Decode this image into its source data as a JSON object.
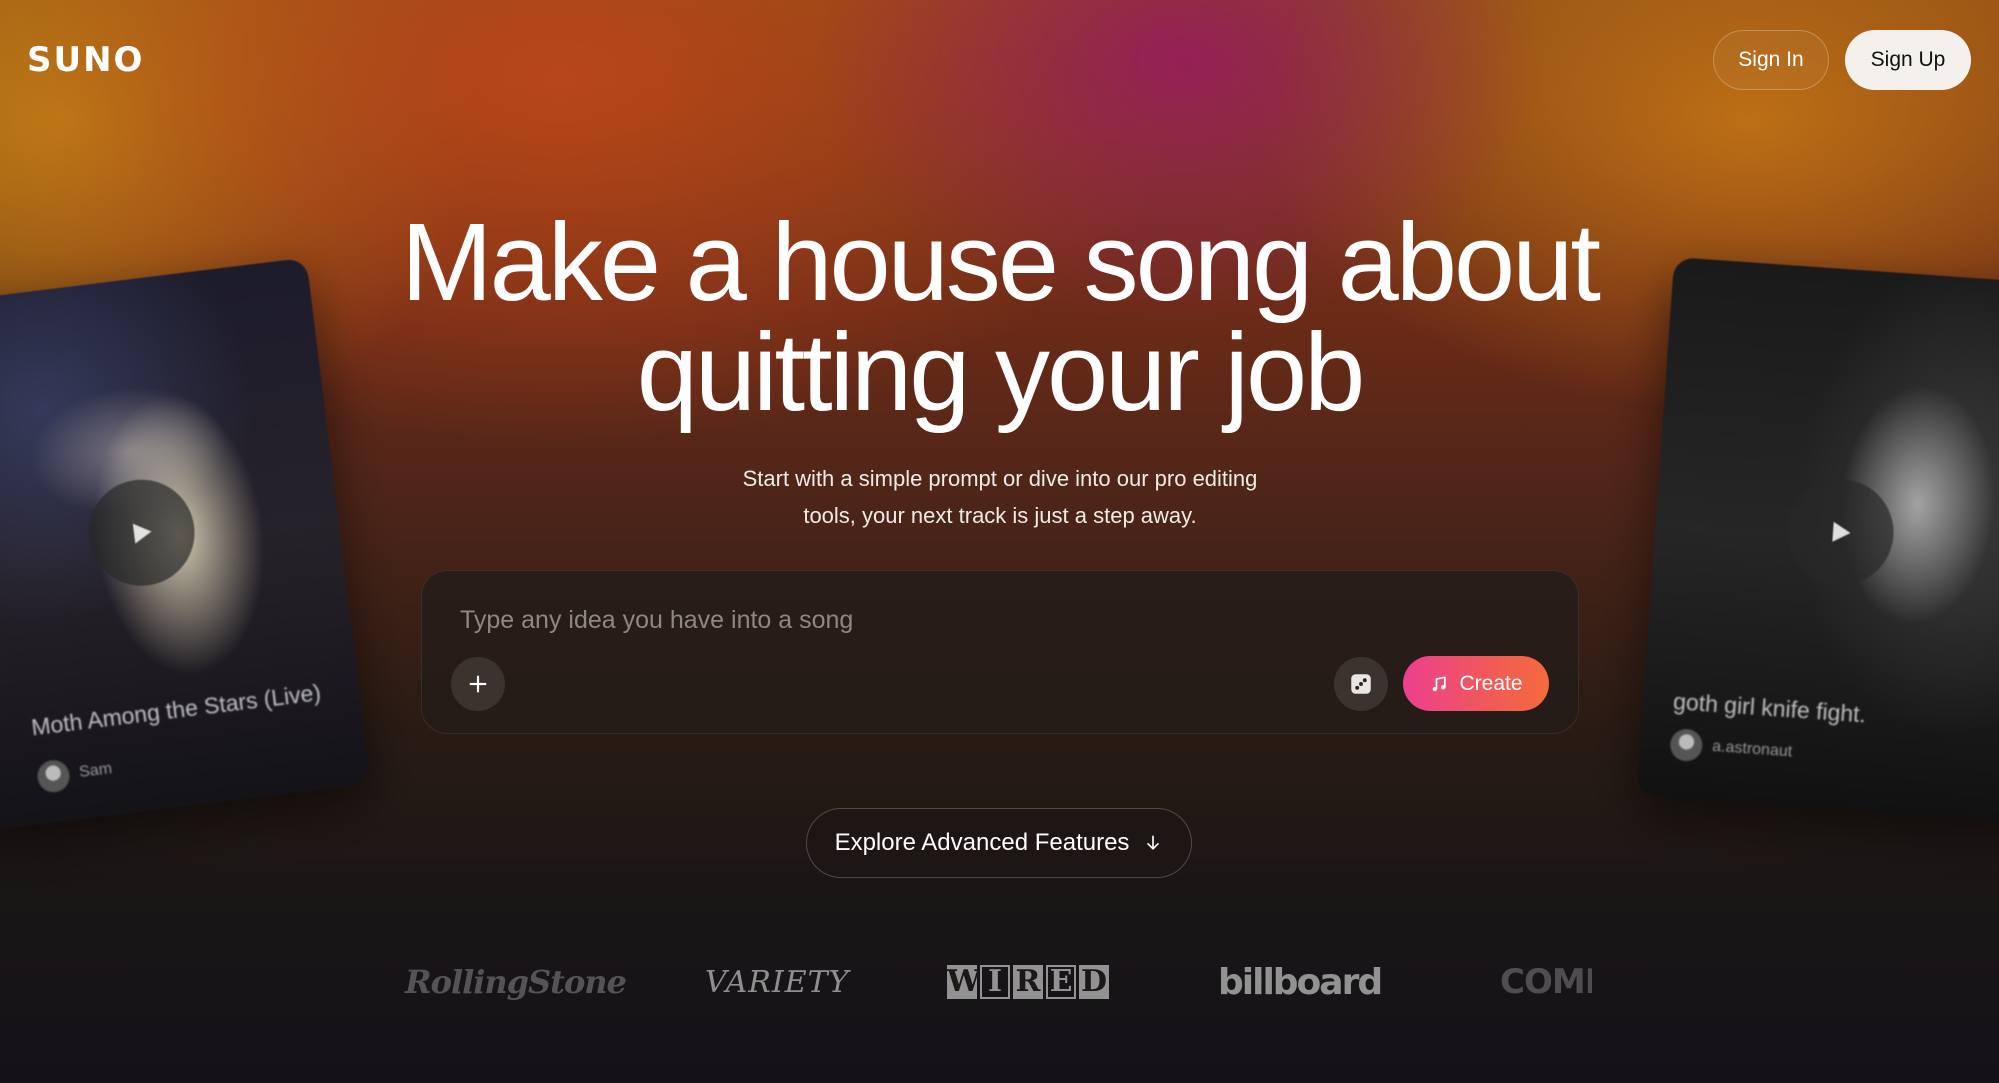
{
  "header": {
    "logo": "SUNO",
    "sign_in_label": "Sign In",
    "sign_up_label": "Sign Up"
  },
  "hero": {
    "title_line1": "Make a house song about",
    "title_line2": "quitting your job",
    "subtitle_line1": "Start with a simple prompt or dive into our pro editing",
    "subtitle_line2": "tools, your next track is just a step away."
  },
  "prompt": {
    "placeholder": "Type any idea you have into a song",
    "value": "",
    "create_label": "Create",
    "plus_icon": "plus-icon",
    "dice_icon": "dice-icon",
    "music_icon": "music-note-icon"
  },
  "explore": {
    "label": "Explore Advanced Features",
    "icon": "arrow-down-icon"
  },
  "cards": [
    {
      "title": "Moth Among the Stars (Live)",
      "author": "Sam"
    },
    {
      "title": "goth girl knife fight.",
      "author": "a.astronaut"
    }
  ],
  "press": {
    "rolling_stone": "RollingStone",
    "variety": "VARIETY",
    "wired": [
      "W",
      "I",
      "R",
      "E",
      "D"
    ],
    "billboard": "billboard",
    "complex": "COMPLEX"
  },
  "colors": {
    "create_gradient_start": "#ec3f8f",
    "create_gradient_end": "#f46a3d",
    "sign_up_bg": "#f4f1ec"
  }
}
